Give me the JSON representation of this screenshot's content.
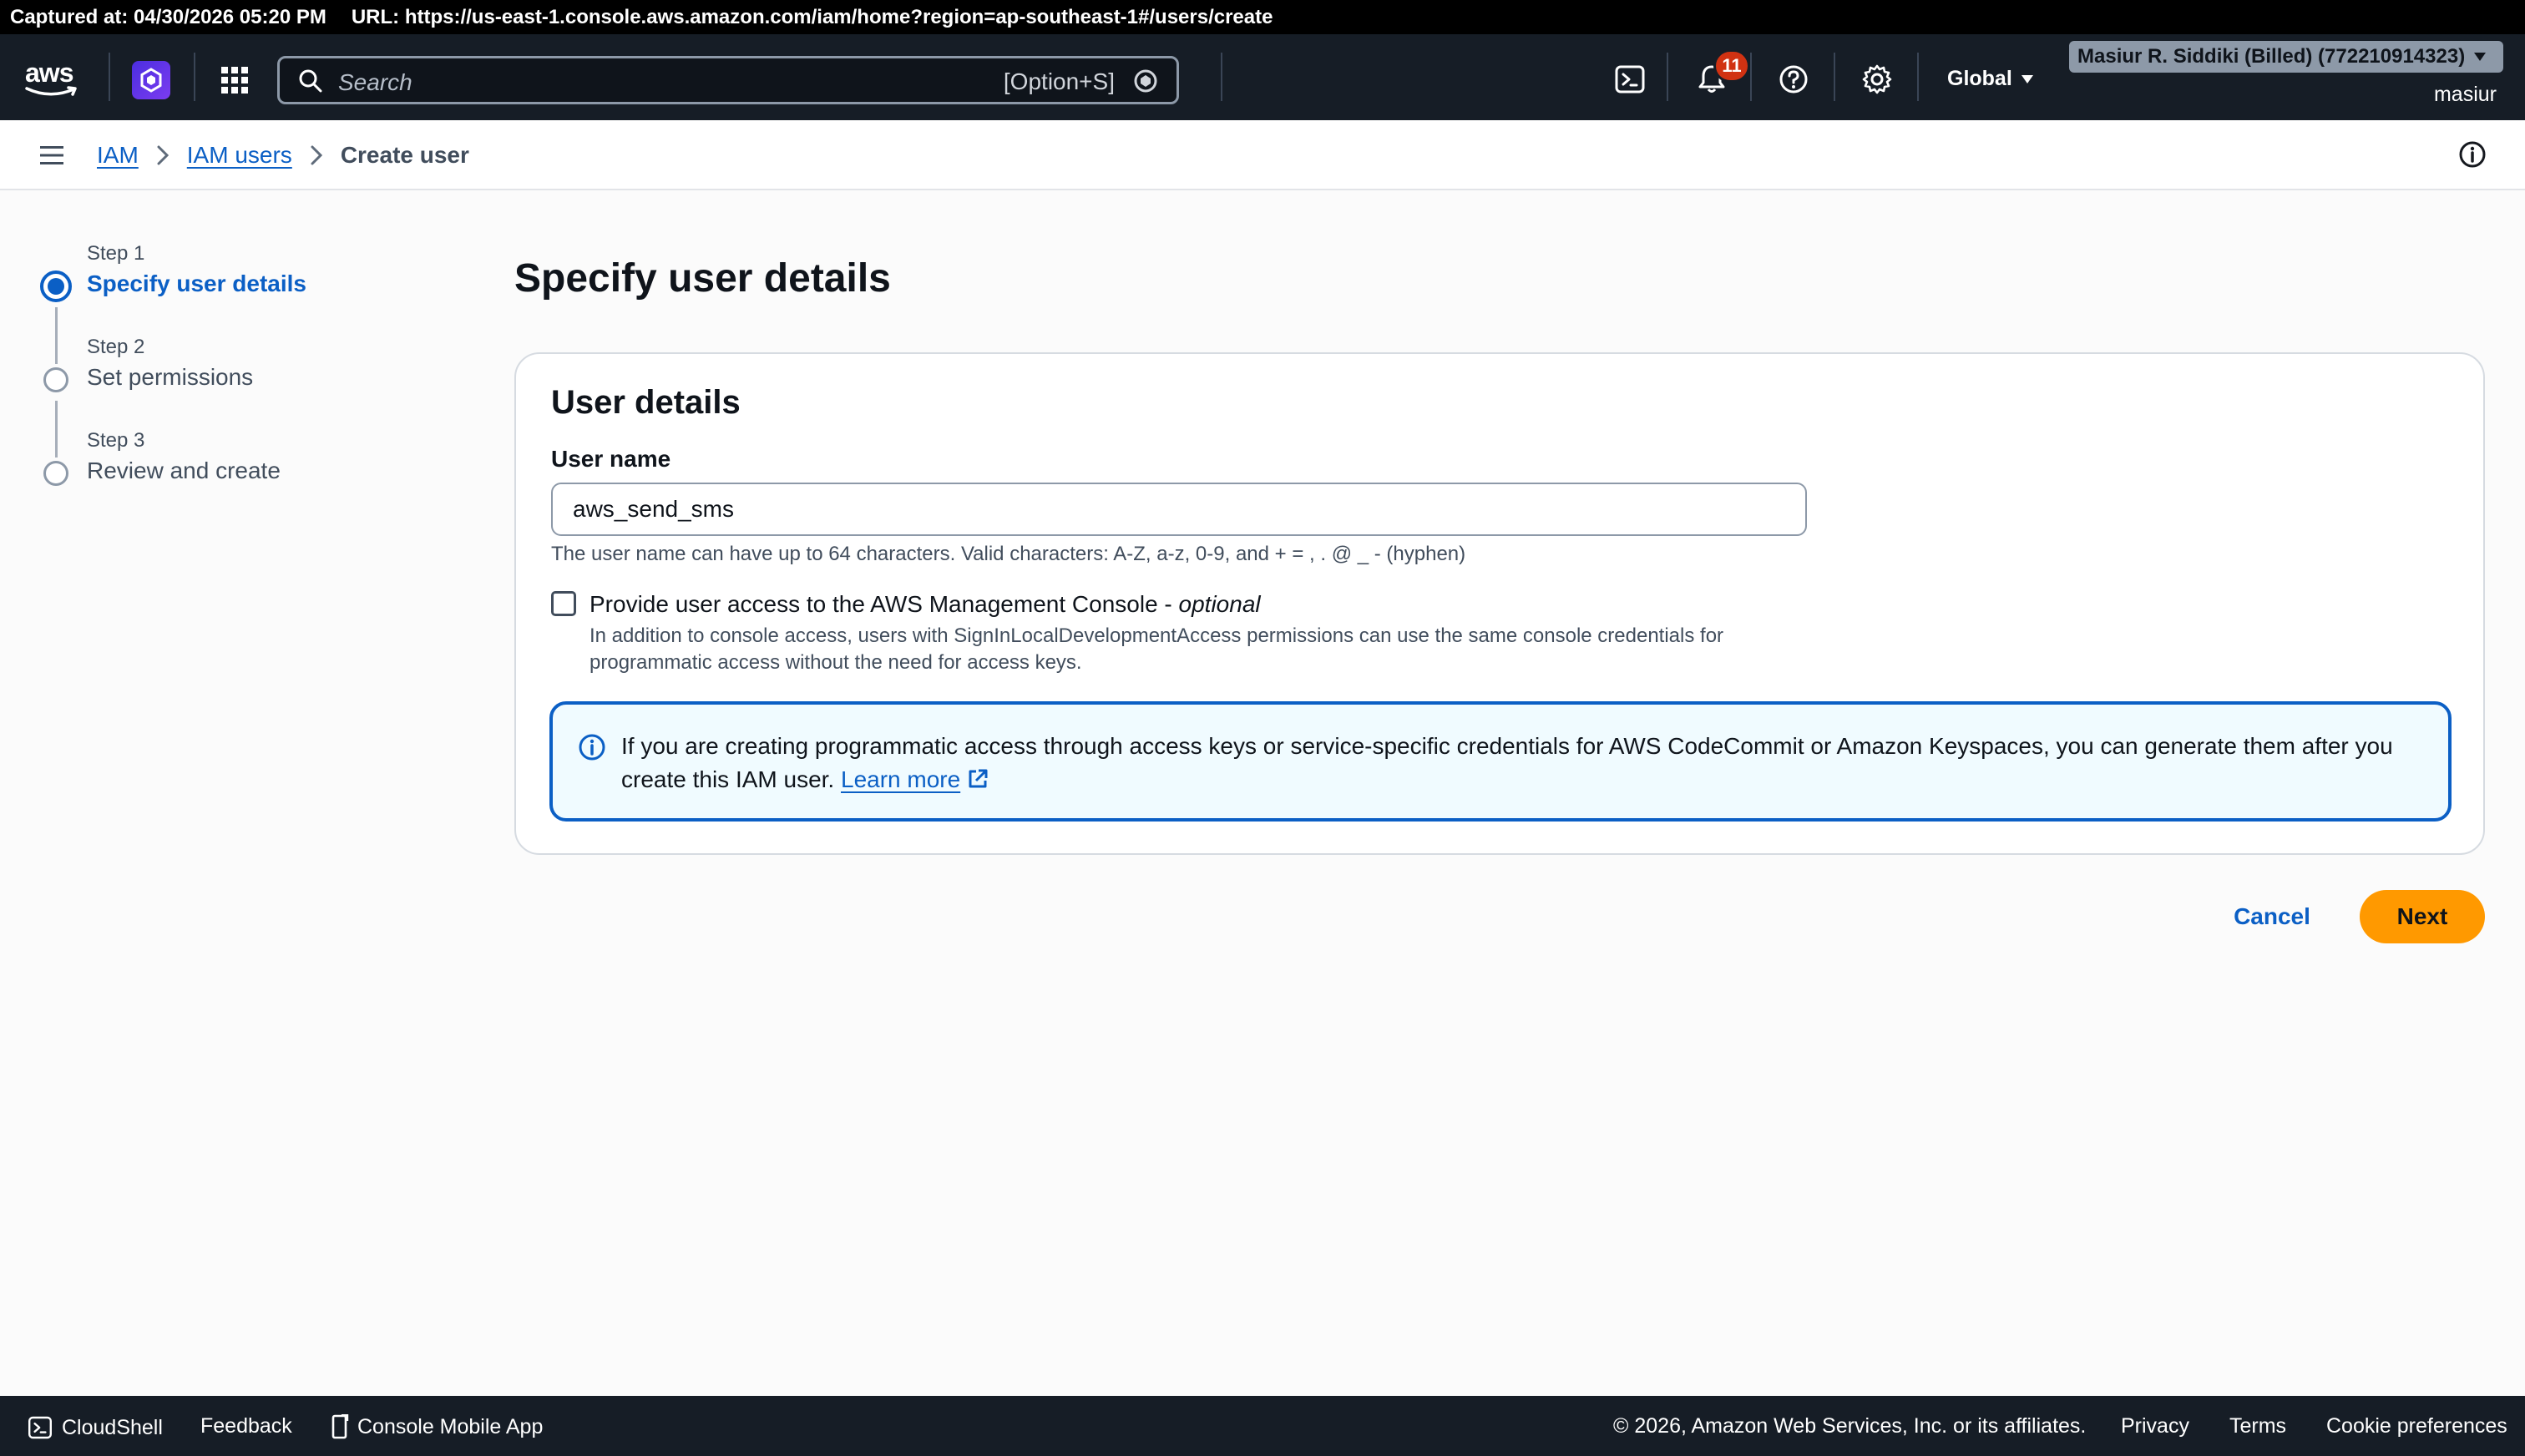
{
  "capture": {
    "timestamp": "Captured at: 04/30/2026 05:20 PM",
    "url": "URL: https://us-east-1.console.aws.amazon.com/iam/home?region=ap-southeast-1#/users/create"
  },
  "topnav": {
    "logo_text": "aws",
    "search_placeholder": "Search",
    "search_shortcut": "[Option+S]",
    "notification_count": "11",
    "region": "Global",
    "account": "Masiur R. Siddiki (Billed) (772210914323)",
    "user": "masiur"
  },
  "breadcrumb": {
    "items": [
      "IAM",
      "IAM users"
    ],
    "current": "Create user"
  },
  "steps": [
    {
      "label": "Step 1",
      "title": "Specify user details"
    },
    {
      "label": "Step 2",
      "title": "Set permissions"
    },
    {
      "label": "Step 3",
      "title": "Review and create"
    }
  ],
  "main": {
    "page_title": "Specify user details",
    "panel_title": "User details",
    "username_label": "User name",
    "username_value": "aws_send_sms",
    "username_hint": "The user name can have up to 64 characters. Valid characters: A-Z, a-z, 0-9, and + = , . @ _ - (hyphen)",
    "console_access_label": "Provide user access to the AWS Management Console - ",
    "console_access_optional": "optional",
    "console_access_desc": "In addition to console access, users with SignInLocalDevelopmentAccess permissions can use the same console credentials for programmatic access without the need for access keys.",
    "alert_text": "If you are creating programmatic access through access keys or service-specific credentials for AWS CodeCommit or Amazon Keyspaces, you can generate them after you create this IAM user. ",
    "alert_link": "Learn more",
    "cancel_label": "Cancel",
    "next_label": "Next"
  },
  "footer": {
    "cloudshell": "CloudShell",
    "feedback": "Feedback",
    "mobile_app": "Console Mobile App",
    "copyright": "© 2026, Amazon Web Services, Inc. or its affiliates.",
    "privacy": "Privacy",
    "terms": "Terms",
    "cookies": "Cookie preferences"
  },
  "colors": {
    "nav_bg": "#161d26",
    "link": "#0b5fc5",
    "primary_button": "#ff9900",
    "badge": "#d13212",
    "alert_bg": "#f0fbff"
  }
}
